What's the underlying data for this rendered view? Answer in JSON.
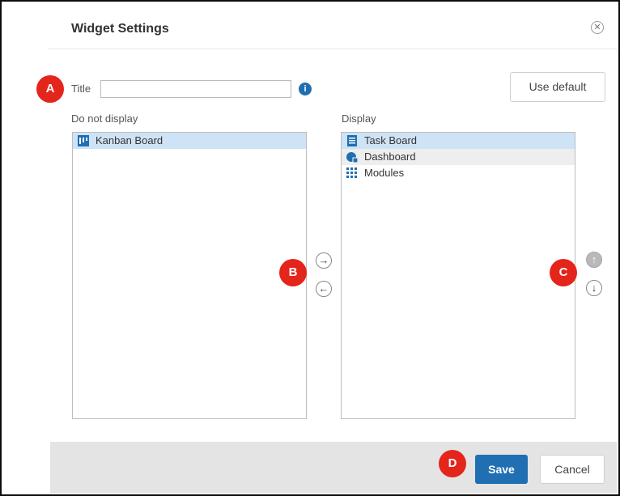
{
  "dialog": {
    "title": "Widget Settings",
    "close_glyph": "✕"
  },
  "form": {
    "title_label": "Title",
    "title_value": "",
    "info_glyph": "i",
    "use_default_label": "Use default"
  },
  "lists": {
    "left_header": "Do not display",
    "right_header": "Display",
    "left_items": [
      {
        "label": "Kanban Board",
        "icon": "kanban-icon",
        "selected": true
      }
    ],
    "right_items": [
      {
        "label": "Task Board",
        "icon": "task-board-icon",
        "selected": true
      },
      {
        "label": "Dashboard",
        "icon": "dashboard-icon",
        "selected": false
      },
      {
        "label": "Modules",
        "icon": "modules-icon",
        "selected": false
      }
    ]
  },
  "controls": {
    "move_right_glyph": "→",
    "move_left_glyph": "←",
    "move_up_glyph": "↑",
    "move_down_glyph": "↓"
  },
  "markers": {
    "a": "A",
    "b": "B",
    "c": "C",
    "d": "D"
  },
  "footer": {
    "save_label": "Save",
    "cancel_label": "Cancel"
  },
  "colors": {
    "accent": "#1f6fb2",
    "marker": "#e4251b",
    "selection": "#cfe3f6"
  }
}
